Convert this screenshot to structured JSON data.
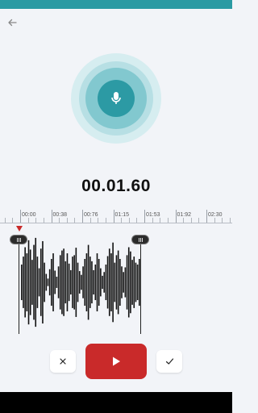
{
  "status_bar": {
    "color": "#2a9aa3"
  },
  "nav": {
    "back_icon": "arrow-left-icon"
  },
  "recorder": {
    "icon": "microphone-icon",
    "timer": "00.01.60"
  },
  "timeline": {
    "ticks": [
      "00:00",
      "00:38",
      "00:76",
      "01:15",
      "01:53",
      "01:92",
      "02:30"
    ]
  },
  "waveform": {
    "amplitudes": [
      0.38,
      0.55,
      0.75,
      0.62,
      0.9,
      0.7,
      0.48,
      0.8,
      0.95,
      0.55,
      0.3,
      0.72,
      0.88,
      0.42,
      0.18,
      0.08,
      0.28,
      0.5,
      0.62,
      0.25,
      0.12,
      0.34,
      0.58,
      0.68,
      0.72,
      0.45,
      0.62,
      0.4,
      0.26,
      0.55,
      0.58,
      0.74,
      0.42,
      0.24,
      0.16,
      0.34,
      0.5,
      0.62,
      0.8,
      0.55,
      0.45,
      0.26,
      0.38,
      0.62,
      0.5,
      0.3,
      0.14,
      0.22,
      0.38,
      0.56,
      0.72,
      0.62,
      0.85,
      0.42,
      0.58,
      0.68,
      0.5,
      0.34,
      0.22,
      0.32,
      0.58,
      0.75,
      0.66,
      0.48,
      0.55,
      0.42,
      0.38,
      0.5
    ],
    "bar_color": "#111111"
  },
  "controls": {
    "cancel_icon": "close-icon",
    "play_icon": "play-icon",
    "confirm_icon": "check-icon",
    "play_color": "#c92a2a"
  }
}
